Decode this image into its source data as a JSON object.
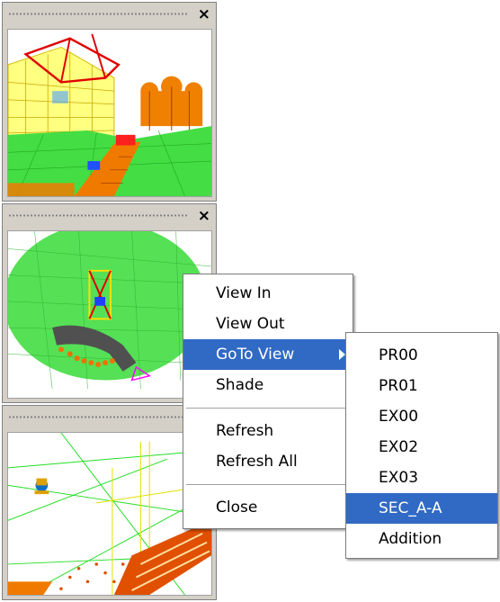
{
  "panels": [
    {
      "name": "view-panel-1",
      "close_label": "×"
    },
    {
      "name": "view-panel-2",
      "close_label": "×"
    },
    {
      "name": "view-panel-3",
      "close_label": ""
    }
  ],
  "context_menu": {
    "view_in": "View In",
    "view_out": "View Out",
    "goto_view": "GoTo View",
    "shade": "Shade",
    "refresh": "Refresh",
    "refresh_all": "Refresh All",
    "close": "Close"
  },
  "goto_submenu": {
    "items": [
      "PR00",
      "PR01",
      "EX00",
      "EX02",
      "EX03",
      "SEC_A-A",
      "Addition"
    ],
    "highlighted": "SEC_A-A"
  },
  "colors": {
    "menu_highlight": "#316ac5",
    "panel_bg": "#d4d0c8"
  }
}
